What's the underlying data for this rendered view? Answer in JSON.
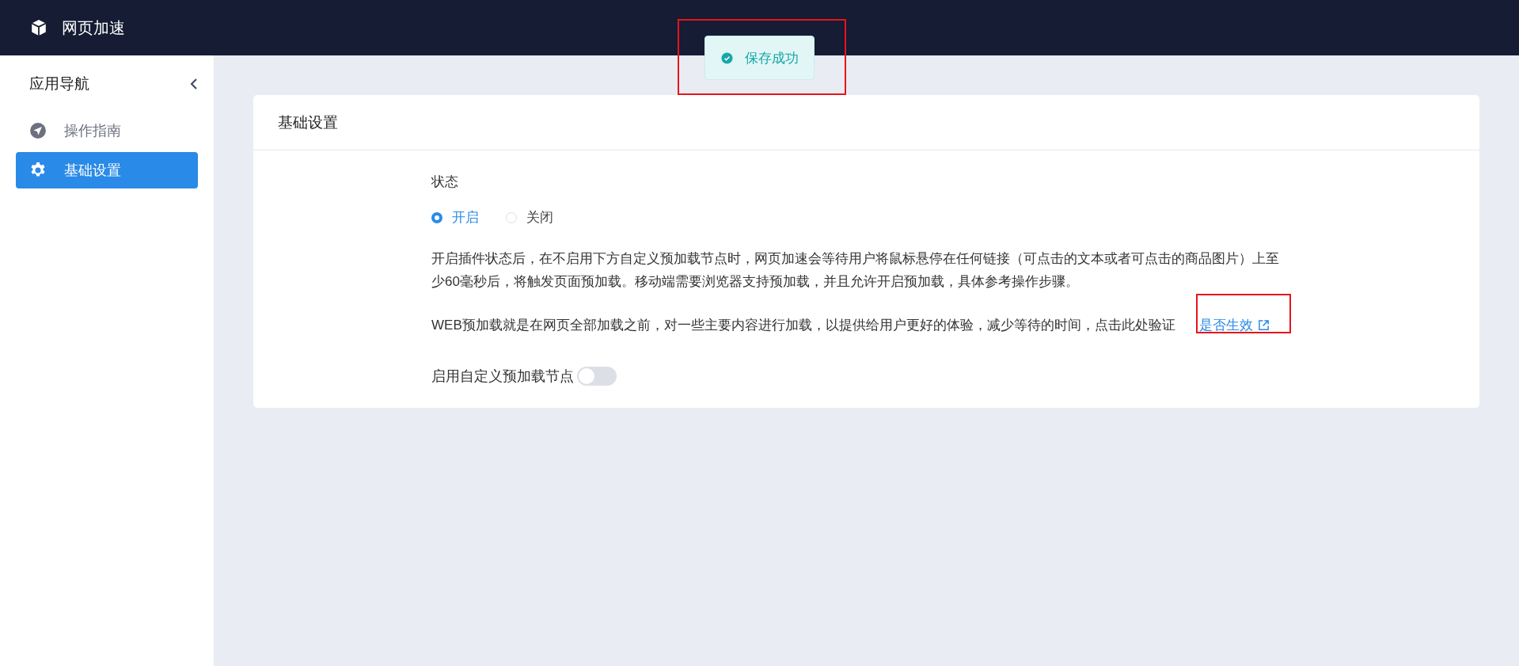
{
  "header": {
    "title": "网页加速"
  },
  "toast": {
    "message": "保存成功"
  },
  "sidebar": {
    "title": "应用导航",
    "items": [
      {
        "label": "操作指南",
        "selected": false
      },
      {
        "label": "基础设置",
        "selected": true
      }
    ]
  },
  "card": {
    "title": "基础设置",
    "status": {
      "label": "状态",
      "options": [
        {
          "label": "开启",
          "selected": true
        },
        {
          "label": "关闭",
          "selected": false
        }
      ]
    },
    "paragraphs": [
      {
        "text": "开启插件状态后，在不启用下方自定义预加载节点时，网页加速会等待用户将鼠标悬停在任何链接（可点击的文本或者可点击的商品图片）上至少60毫秒后，将触发页面预加载。移动端需要浏览器支持预加载，并且允许开启预加载，具体参考操作步骤。"
      },
      {
        "text": "WEB预加载就是在网页全部加载之前，对一些主要内容进行加载，以提供给用户更好的体验，减少等待的时间，点击此处验证",
        "link": "是否生效"
      }
    ],
    "switch": {
      "label": "启用自定义预加载节点",
      "on": false
    }
  }
}
